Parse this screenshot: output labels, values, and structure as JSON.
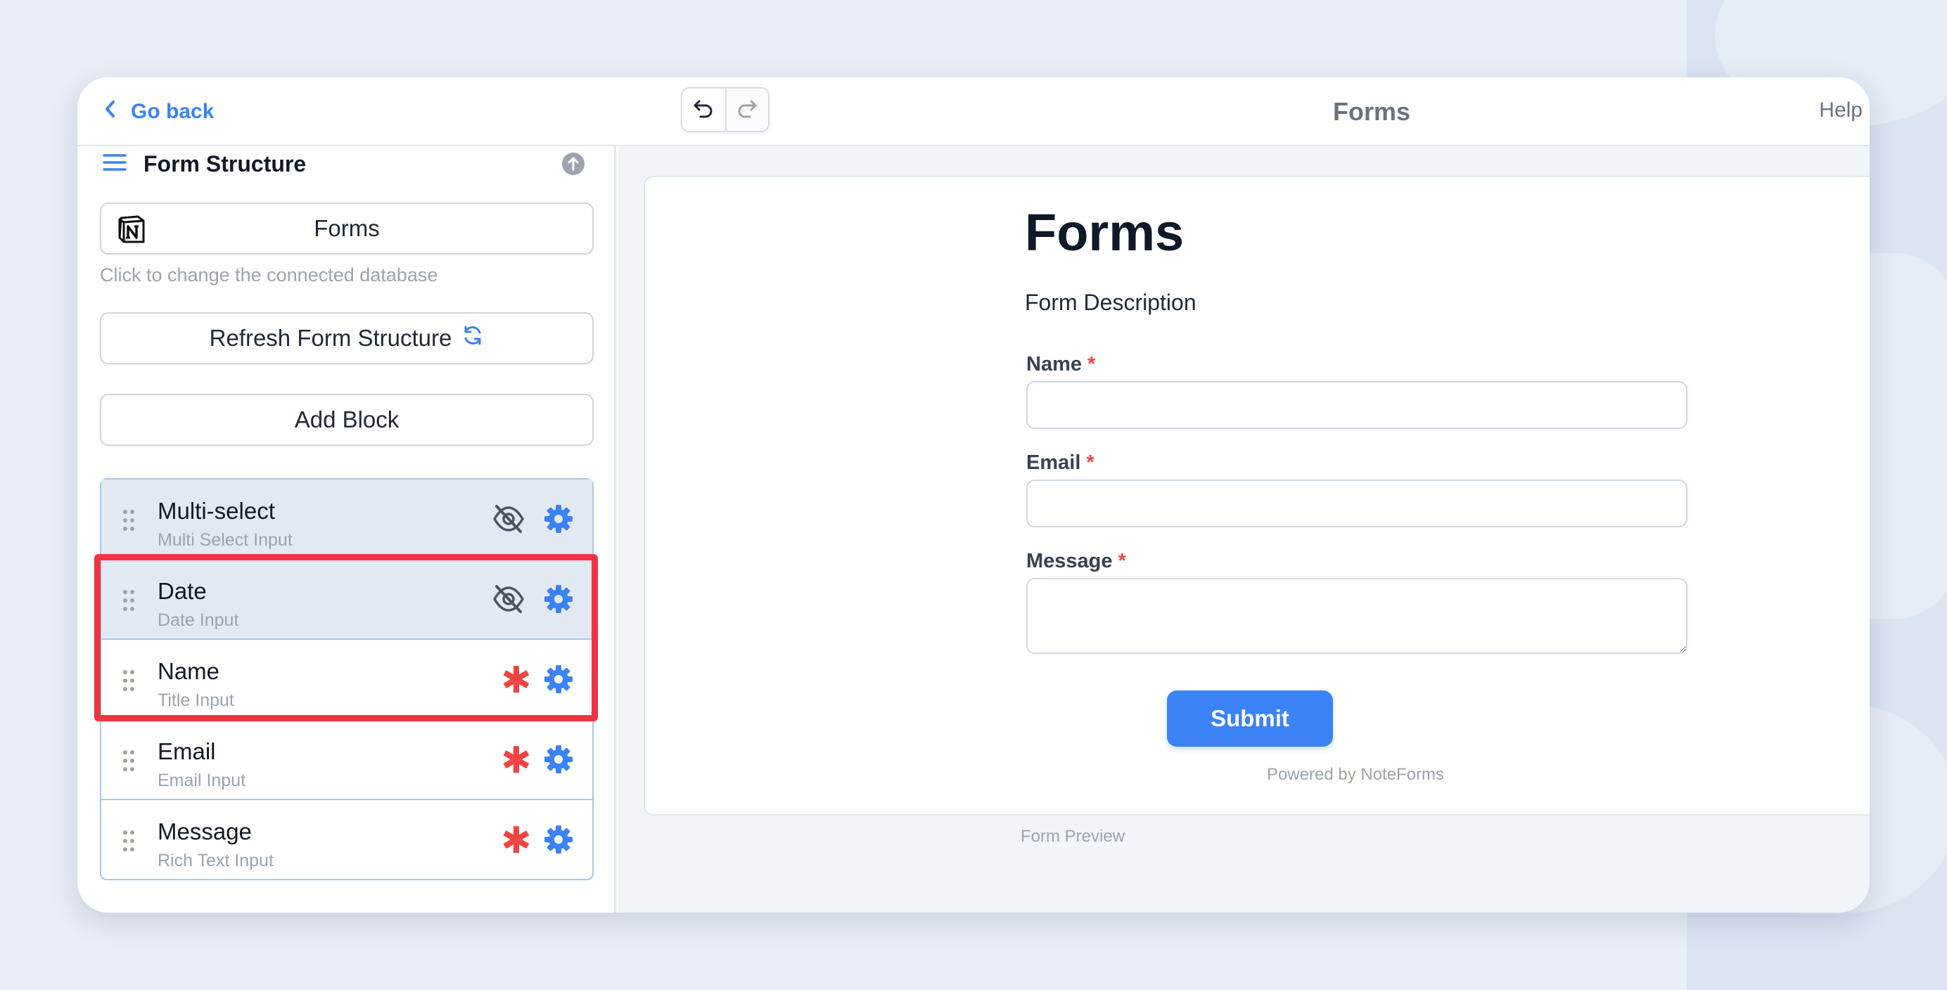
{
  "topbar": {
    "go_back": "Go back",
    "title": "Forms",
    "help": "Help",
    "undo_icon": "undo-icon",
    "redo_icon": "redo-icon"
  },
  "sidebar": {
    "title": "Form Structure",
    "database_button": "Forms",
    "database_hint": "Click to change the connected database",
    "refresh_button": "Refresh Form Structure",
    "add_block_button": "Add Block",
    "blocks": [
      {
        "title": "Multi-select",
        "subtitle": "Multi Select Input",
        "status": "hidden"
      },
      {
        "title": "Date",
        "subtitle": "Date Input",
        "status": "hidden"
      },
      {
        "title": "Name",
        "subtitle": "Title Input",
        "status": "required"
      },
      {
        "title": "Email",
        "subtitle": "Email Input",
        "status": "required"
      },
      {
        "title": "Message",
        "subtitle": "Rich Text Input",
        "status": "required"
      }
    ],
    "required_marker": "✱"
  },
  "form": {
    "title": "Forms",
    "description": "Form Description",
    "fields": [
      {
        "label": "Name",
        "required_mark": "*",
        "value": ""
      },
      {
        "label": "Email",
        "required_mark": "*",
        "value": ""
      },
      {
        "label": "Message",
        "required_mark": "*",
        "value": ""
      }
    ],
    "submit": "Submit",
    "powered_by": "Powered by NoteForms"
  },
  "preview_caption": "Form Preview",
  "colors": {
    "accent": "#3b82f6",
    "required": "#ef4444",
    "highlight": "#ef3340",
    "background": "#e9edf6"
  }
}
